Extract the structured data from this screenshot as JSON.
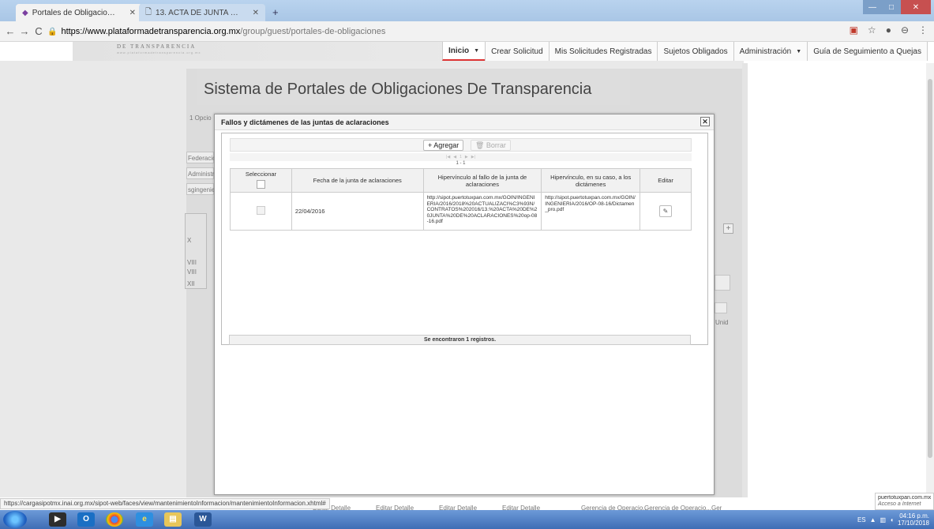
{
  "browser": {
    "tabs": [
      {
        "title": "Portales de Obligaciones de Tran"
      },
      {
        "title": "13. ACTA DE JUNTA DE ACLARAC"
      }
    ],
    "url_host": "https://www.plataformadetransparencia.org.mx",
    "url_path": "/group/guest/portales-de-obligaciones"
  },
  "site": {
    "logo_text": "DE  TRANSPARENCIA",
    "logo_sub": "www.plataformadetransparencia.org.mx",
    "menu": [
      "Inicio",
      "Crear Solicitud",
      "Mis Solicitudes Registradas",
      "Sujetos Obligados",
      "Administración",
      "Guía de Seguimiento a Quejas"
    ]
  },
  "page": {
    "title": "Sistema de Portales de Obligaciones De Transparencia",
    "bg_labels": [
      "1 Opcio",
      "Federació",
      "Administra",
      "sgingenier",
      "X",
      "VIII",
      "VIII",
      "XII",
      "Unid"
    ],
    "bottom_cells": [
      "Editar Detalle",
      "Editar Detalle",
      "Editar Detalle",
      "Editar Detalle",
      "Gerencia de Operacio...",
      "Gerencia de Operacio...",
      "Ger"
    ]
  },
  "modal": {
    "title": "Fallos y dictámenes de las juntas de aclaraciones",
    "add_label": "+ Agregar",
    "delete_label": "🗑 Borrar",
    "record_count": "1 - 1",
    "pager_glyphs": [
      "|◀",
      "◀",
      "1",
      "▶",
      "▶|"
    ],
    "columns": [
      "Seleccionar",
      "Fecha de la junta de aclaraciones",
      "Hipervínculo al fallo de la junta de aclaraciones",
      "Hipervínculo, en su caso, a los dictámenes",
      "Editar"
    ],
    "rows": [
      {
        "fecha": "22/04/2016",
        "fallo_url": "http://sipot.puertotuxpan.com.mx/GOIN/INGENIERIA/2016/2018%20ACTUALIZACI%C3%93N/CONTRATOS%202016/13.%20ACTA%20DE%20JUNTA%20DE%20ACLARACIONES%20op-08-16.pdf",
        "dictamen_url": "http://sipot.puertotuxpan.com.mx/GOIN/INGENIERIA/2016/OP-08-16/Dictamen_pro.pdf"
      }
    ],
    "footer": "Se encontraron 1 registros."
  },
  "status_url": "https://cargasipotmx.inai.org.mx/sipot-web/faces/view/mantenimientoInformacion/mantenimientoInformacion.xhtml#",
  "toast": {
    "line1": "puertotuxpan.com.mx",
    "line2": "Acceso a Internet"
  },
  "clock": {
    "time": "04:16 p.m.",
    "date": "17/10/2018"
  },
  "tray_lang": "ES",
  "colors": {
    "accent_red": "#d33333",
    "taskbar": "#3e6db5"
  }
}
